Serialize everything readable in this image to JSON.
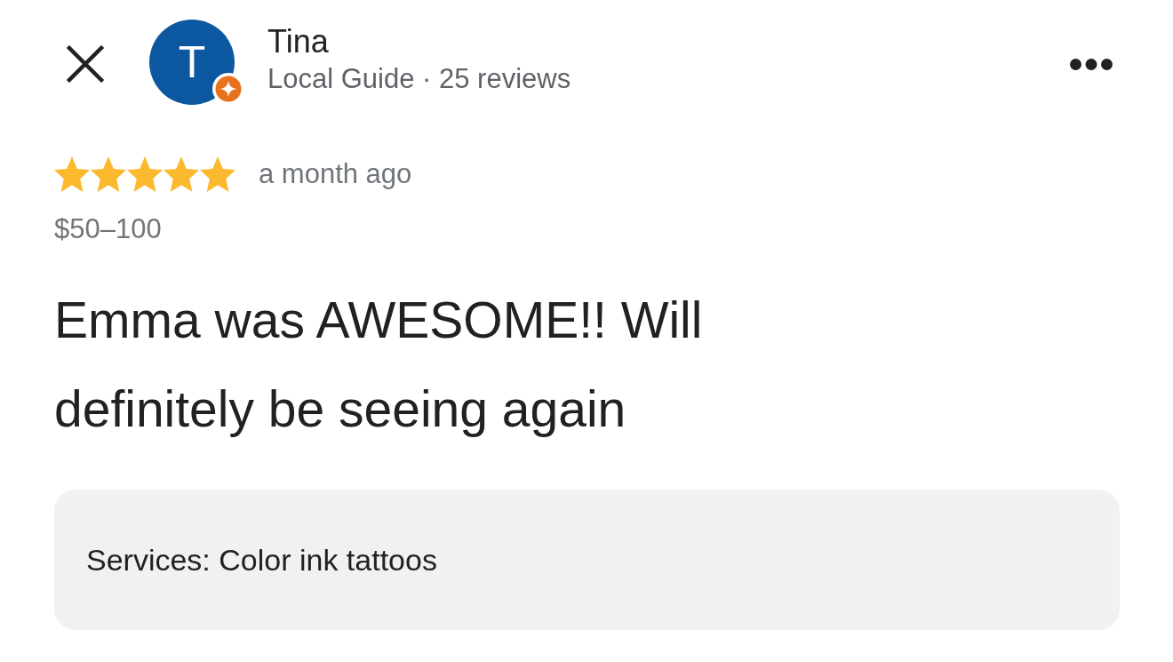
{
  "reviewer": {
    "initial": "T",
    "local_guide": true,
    "name": "Tina",
    "subtitle": "Local Guide · 25 reviews"
  },
  "rating": {
    "stars": 5,
    "time": "a month ago"
  },
  "price": "$50–100",
  "review_text": "Emma was AWESOME!! Will definitely be seeing again",
  "details": [
    "Services: Color ink tattoos"
  ]
}
